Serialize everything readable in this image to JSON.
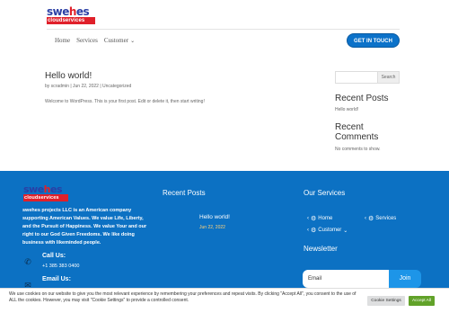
{
  "header": {
    "logo_top_a": "swe",
    "logo_top_b": "h",
    "logo_top_c": "es",
    "logo_bottom": "cloudservices",
    "nav": [
      {
        "label": "Home"
      },
      {
        "label": "Services"
      },
      {
        "label": "Customer"
      }
    ],
    "cta_label": "GET IN TOUCH"
  },
  "post": {
    "title": "Hello world!",
    "meta": "by scradmin | Jun 22, 2022 | Uncategorized",
    "excerpt": "Welcome to WordPress. This is your first post. Edit or delete it, then start writing!"
  },
  "sidebar": {
    "search_button": "Search",
    "recent_posts_heading": "Recent Posts",
    "recent_posts": [
      "Hello world!"
    ],
    "recent_comments_heading": "Recent Comments",
    "no_comments": "No comments to show."
  },
  "footer": {
    "description": "swehes projects LLC is an American company supporting American Values. We value Life, Liberty, and the Pursuit of Happiness. We value Your and our right to our God Given Freedoms. We like doing business with likeminded people.",
    "call_label": "Call Us:",
    "call_value": "+1 385 383 0400",
    "email_label": "Email Us:",
    "recent_posts_heading": "Recent Posts",
    "recent_post_title": "Hello world!",
    "recent_post_date": "Jun 22, 2022",
    "services_heading": "Our Services",
    "services": {
      "home": "Home",
      "services": "Services",
      "customer": "Customer"
    },
    "newsletter_heading": "Newsletter",
    "email_placeholder": "Email",
    "join_label": "Join"
  },
  "cookie": {
    "text": "We use cookies on our website to give you the most relevant experience by remembering your preferences and repeat visits. By clicking \"Accept All\", you consent to the use of ALL the cookies. However, you may visit \"Cookie Settings\" to provide a controlled consent.",
    "settings_label": "Cookie Settings",
    "accept_label": "Accept All"
  },
  "colors": {
    "brand_blue": "#0c71c3",
    "logo_red": "#e0202a",
    "accept_green": "#61a229"
  },
  "icons": [
    "chevron-down-icon",
    "phone-icon",
    "mail-icon",
    "arrow-icon",
    "gear-icon"
  ]
}
